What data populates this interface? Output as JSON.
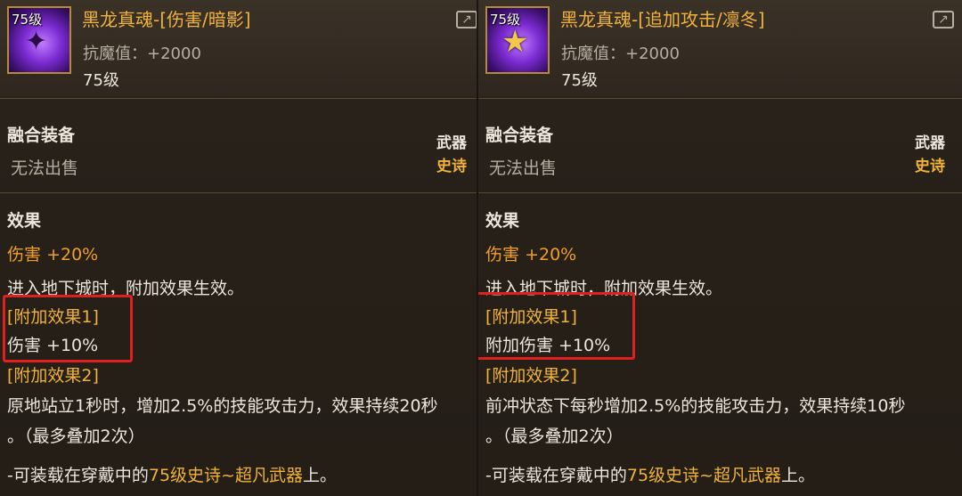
{
  "left": {
    "icon_level": "75级",
    "name": "黑龙真魂-[伤害/暗影]",
    "anti_magic": "抗魔值：+2000",
    "level": "75级",
    "type": "融合装备",
    "unsellable": "无法出售",
    "slot": "武器",
    "rarity": "史诗",
    "effect_title": "效果",
    "damage_label": "伤害",
    "damage_value": "+20%",
    "dungeon_note": "进入地下城时，附加效果生效。",
    "extra1_title": "[附加效果1]",
    "extra1_value": "伤害 +10%",
    "extra2_title": "[附加效果2]",
    "extra2_desc_line1": "原地站立1秒时，增加2.5%的技能攻击力，效果持续20秒",
    "extra2_desc_line2": "。（最多叠加2次）",
    "equip_prefix": "-可装载在穿戴中的",
    "equip_highlight": "75级史诗~超凡武器",
    "equip_suffix": "上。"
  },
  "right": {
    "icon_level": "75级",
    "name": "黑龙真魂-[追加攻击/凛冬]",
    "anti_magic": "抗魔值：+2000",
    "level": "75级",
    "type": "融合装备",
    "unsellable": "无法出售",
    "slot": "武器",
    "rarity": "史诗",
    "effect_title": "效果",
    "damage_label": "伤害",
    "damage_value": "+20%",
    "dungeon_note": "进入地下城时，附加效果生效。",
    "extra1_title": "[附加效果1]",
    "extra1_value": "附加伤害 +10%",
    "extra2_title": "[附加效果2]",
    "extra2_desc_line1": "前冲状态下每秒增加2.5%的技能攻击力，效果持续10秒",
    "extra2_desc_line2": "。（最多叠加2次）",
    "equip_prefix": "-可装载在穿戴中的",
    "equip_highlight": "75级史诗~超凡武器",
    "equip_suffix": "上。"
  },
  "colors": {
    "name_gold": "#f0b23a",
    "damage_orange": "#f0a028",
    "highlight_red": "#e01f1f"
  },
  "icons": {
    "left_item": "dark-dragon-soul-icon",
    "right_item": "star-dragon-soul-icon",
    "share": "share-icon"
  }
}
